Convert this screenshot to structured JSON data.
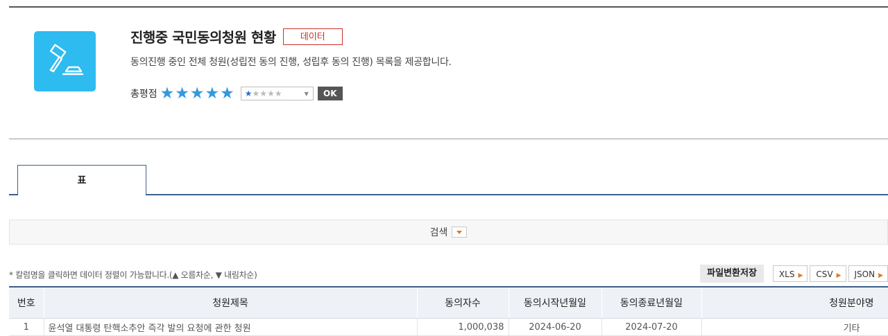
{
  "header": {
    "title": "진행중 국민동의청원 현황",
    "badge": "데이터",
    "description": "동의진행 중인 전체 청원(성립전 동의 진행, 성립후 동의 진행) 목록을 제공합니다.",
    "app_icon": "gavel-icon",
    "accent_color": "#2ebbf0"
  },
  "rating": {
    "label": "총평점",
    "score": 5,
    "max": 5,
    "select_value": 1,
    "ok_label": "OK"
  },
  "tabs": [
    {
      "label": "표"
    }
  ],
  "search": {
    "label": "검색"
  },
  "note": "* 칼럼명을 클릭하면 데이터 정렬이 가능합니다.(▲ 오름차순, ▼ 내림차순)",
  "file_export": {
    "label": "파일변환저장",
    "formats": [
      "XLS",
      "CSV",
      "JSON"
    ]
  },
  "table": {
    "columns": [
      "번호",
      "청원제목",
      "동의자수",
      "동의시작년월일",
      "동의종료년월일",
      "청원분야명"
    ],
    "rows": [
      [
        "1",
        "윤석열 대통령 탄핵소추안 즉각 발의 요청에 관한 청원",
        "1,000,038",
        "2024-06-20",
        "2024-07-20",
        "기타"
      ]
    ]
  }
}
